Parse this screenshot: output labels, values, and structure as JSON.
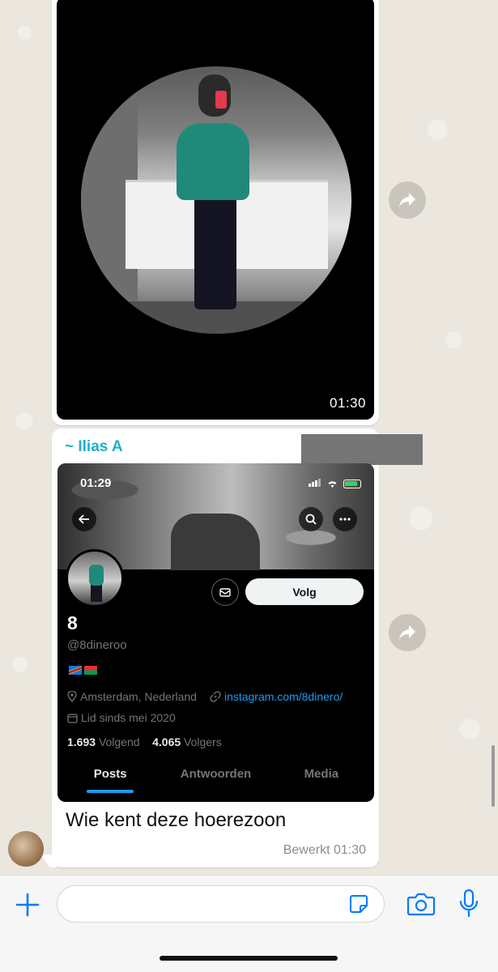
{
  "message1": {
    "video_time": "01:30"
  },
  "message2": {
    "sender_name": "~ Ilias A",
    "caption": "Wie kent deze hoerezoon",
    "meta": "Bewerkt 01:30"
  },
  "profile_screenshot": {
    "status_time": "01:29",
    "display_name": "8",
    "handle": "@8dineroo",
    "follow_label": "Volg",
    "location": "Amsterdam, Nederland",
    "link": "instagram.com/8dinero/",
    "joined": "Lid sinds mei 2020",
    "following_count": "1.693",
    "following_label": "Volgend",
    "followers_count": "4.065",
    "followers_label": "Volgers",
    "tabs": [
      {
        "label": "Posts"
      },
      {
        "label": "Antwoorden"
      },
      {
        "label": "Media"
      }
    ]
  },
  "input": {
    "value": ""
  },
  "colors": {
    "sender_name": "#1fb0c8",
    "link": "#1d9bf0",
    "accent_blue": "#007aff"
  },
  "icons": [
    "forward-icon",
    "back-arrow-icon",
    "search-icon",
    "more-icon",
    "mail-icon",
    "location-icon",
    "link-icon",
    "calendar-icon",
    "plus-icon",
    "sticker-icon",
    "camera-icon",
    "microphone-icon"
  ]
}
